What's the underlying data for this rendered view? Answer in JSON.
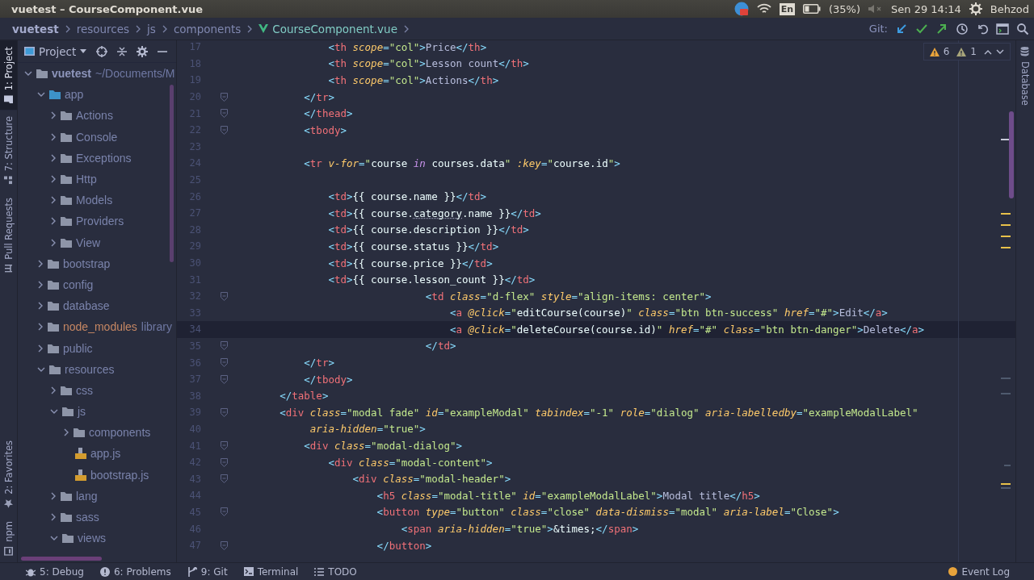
{
  "window": {
    "title": "vuetest – CourseComponent.vue"
  },
  "system_tray": {
    "keyboard": "En",
    "battery": "(35%)",
    "clock": "Sen 29 14:14",
    "user": "Behzod"
  },
  "breadcrumbs": [
    {
      "label": "vuetest",
      "kind": "project"
    },
    {
      "label": "resources",
      "kind": "folder"
    },
    {
      "label": "js",
      "kind": "folder"
    },
    {
      "label": "components",
      "kind": "folder"
    },
    {
      "label": "CourseComponent.vue",
      "kind": "vue"
    }
  ],
  "git_toolbar": {
    "label": "Git:"
  },
  "left_tool_tabs": [
    {
      "label": "1: Project",
      "selected": true,
      "kind": "project"
    },
    {
      "label": "7: Structure",
      "selected": false,
      "kind": "structure"
    },
    {
      "label": "Pull Requests",
      "selected": false,
      "kind": "pull"
    }
  ],
  "left_tool_tabs_bottom": [
    {
      "label": "2: Favorites",
      "selected": false,
      "kind": "favorites"
    },
    {
      "label": "npm",
      "selected": false,
      "kind": "npm"
    }
  ],
  "right_tool_tabs": [
    {
      "label": "Database",
      "selected": false,
      "kind": "database"
    }
  ],
  "project_panel": {
    "title": "Project",
    "tree": [
      {
        "label": "vuetest",
        "path": "~/Documents/M",
        "kind": "root",
        "expanded": true,
        "children": [
          {
            "label": "app",
            "kind": "source",
            "expanded": true,
            "children": [
              {
                "label": "Actions",
                "kind": "folder",
                "expanded": false
              },
              {
                "label": "Console",
                "kind": "folder",
                "expanded": false
              },
              {
                "label": "Exceptions",
                "kind": "folder",
                "expanded": false
              },
              {
                "label": "Http",
                "kind": "folder",
                "expanded": false
              },
              {
                "label": "Models",
                "kind": "folder",
                "expanded": false
              },
              {
                "label": "Providers",
                "kind": "folder",
                "expanded": false
              },
              {
                "label": "View",
                "kind": "folder",
                "expanded": false
              }
            ]
          },
          {
            "label": "bootstrap",
            "kind": "folder",
            "expanded": false
          },
          {
            "label": "config",
            "kind": "folder",
            "expanded": false
          },
          {
            "label": "database",
            "kind": "folder",
            "expanded": false
          },
          {
            "label": "node_modules",
            "note": "library",
            "kind": "excluded",
            "expanded": false
          },
          {
            "label": "public",
            "kind": "folder",
            "expanded": false
          },
          {
            "label": "resources",
            "kind": "folder",
            "expanded": true,
            "children": [
              {
                "label": "css",
                "kind": "folder",
                "expanded": false
              },
              {
                "label": "js",
                "kind": "folder",
                "expanded": true,
                "children": [
                  {
                    "label": "components",
                    "kind": "folder",
                    "expanded": false
                  },
                  {
                    "label": "app.js",
                    "kind": "js"
                  },
                  {
                    "label": "bootstrap.js",
                    "kind": "js"
                  }
                ]
              },
              {
                "label": "lang",
                "kind": "folder",
                "expanded": false
              },
              {
                "label": "sass",
                "kind": "folder",
                "expanded": false
              },
              {
                "label": "views",
                "kind": "folder",
                "expanded": true
              }
            ]
          }
        ]
      }
    ]
  },
  "inspections": {
    "warnings": "6",
    "weak_warnings": "1"
  },
  "editor": {
    "lines": [
      {
        "number": "17",
        "fold": false,
        "current": false,
        "segments": [
          {
            "kind": "b",
            "text": "                <"
          },
          {
            "kind": "tag",
            "text": "th"
          },
          {
            "kind": "attr",
            "text": " scope"
          },
          {
            "kind": "b",
            "text": "="
          },
          {
            "kind": "str",
            "text": "\"col\""
          },
          {
            "kind": "b",
            "text": ">"
          },
          {
            "kind": "text",
            "text": "Price"
          },
          {
            "kind": "b",
            "text": "</"
          },
          {
            "kind": "tag",
            "text": "th"
          },
          {
            "kind": "b",
            "text": ">"
          }
        ]
      },
      {
        "number": "18",
        "fold": false,
        "current": false,
        "segments": [
          {
            "kind": "b",
            "text": "                <"
          },
          {
            "kind": "tag",
            "text": "th"
          },
          {
            "kind": "attr",
            "text": " scope"
          },
          {
            "kind": "b",
            "text": "="
          },
          {
            "kind": "str",
            "text": "\"col\""
          },
          {
            "kind": "b",
            "text": ">"
          },
          {
            "kind": "text",
            "text": "Lesson count"
          },
          {
            "kind": "b",
            "text": "</"
          },
          {
            "kind": "tag",
            "text": "th"
          },
          {
            "kind": "b",
            "text": ">"
          }
        ]
      },
      {
        "number": "19",
        "fold": false,
        "current": false,
        "segments": [
          {
            "kind": "b",
            "text": "                <"
          },
          {
            "kind": "tag",
            "text": "th"
          },
          {
            "kind": "attr",
            "text": " scope"
          },
          {
            "kind": "b",
            "text": "="
          },
          {
            "kind": "str",
            "text": "\"col\""
          },
          {
            "kind": "b",
            "text": ">"
          },
          {
            "kind": "text",
            "text": "Actions"
          },
          {
            "kind": "b",
            "text": "</"
          },
          {
            "kind": "tag",
            "text": "th"
          },
          {
            "kind": "b",
            "text": ">"
          }
        ]
      },
      {
        "number": "20",
        "fold": true,
        "current": false,
        "segments": [
          {
            "kind": "b",
            "text": "            </"
          },
          {
            "kind": "tag",
            "text": "tr"
          },
          {
            "kind": "b",
            "text": ">"
          }
        ]
      },
      {
        "number": "21",
        "fold": true,
        "current": false,
        "segments": [
          {
            "kind": "b",
            "text": "            </"
          },
          {
            "kind": "tag",
            "text": "thead"
          },
          {
            "kind": "b",
            "text": ">"
          }
        ]
      },
      {
        "number": "22",
        "fold": true,
        "current": false,
        "segments": [
          {
            "kind": "b",
            "text": "            <"
          },
          {
            "kind": "tag",
            "text": "tbody"
          },
          {
            "kind": "b",
            "text": ">"
          }
        ]
      },
      {
        "number": "23",
        "fold": false,
        "current": false
      },
      {
        "number": "24",
        "fold": false,
        "current": false,
        "segments": [
          {
            "kind": "b",
            "text": "            <"
          },
          {
            "kind": "tag",
            "text": "tr"
          },
          {
            "kind": "attr",
            "text": " v-for"
          },
          {
            "kind": "b",
            "text": "="
          },
          {
            "kind": "str",
            "text": "\""
          },
          {
            "kind": "js",
            "text": "course "
          },
          {
            "kind": "kw",
            "text": "in"
          },
          {
            "kind": "js",
            "text": " courses.data"
          },
          {
            "kind": "str",
            "text": "\""
          },
          {
            "kind": "attr",
            "text": " :key"
          },
          {
            "kind": "b",
            "text": "="
          },
          {
            "kind": "str",
            "text": "\""
          },
          {
            "kind": "js",
            "text": "course.id"
          },
          {
            "kind": "str",
            "text": "\""
          },
          {
            "kind": "b",
            "text": ">"
          }
        ]
      },
      {
        "number": "25",
        "fold": false,
        "current": false
      },
      {
        "number": "26",
        "fold": false,
        "current": false,
        "segments": [
          {
            "kind": "b",
            "text": "                <"
          },
          {
            "kind": "tag",
            "text": "td"
          },
          {
            "kind": "b",
            "text": ">"
          },
          {
            "kind": "js",
            "text": "{{ course.name }}"
          },
          {
            "kind": "b",
            "text": "</"
          },
          {
            "kind": "tag",
            "text": "td"
          },
          {
            "kind": "b",
            "text": ">"
          }
        ]
      },
      {
        "number": "27",
        "fold": false,
        "current": false,
        "segments": [
          {
            "kind": "b",
            "text": "                <"
          },
          {
            "kind": "tag",
            "text": "td"
          },
          {
            "kind": "b",
            "text": ">"
          },
          {
            "kind": "js",
            "text": "{{ course."
          },
          {
            "kind": "warn",
            "text": "category"
          },
          {
            "kind": "js",
            "text": ".name }}"
          },
          {
            "kind": "b",
            "text": "</"
          },
          {
            "kind": "tag",
            "text": "td"
          },
          {
            "kind": "b",
            "text": ">"
          }
        ]
      },
      {
        "number": "28",
        "fold": false,
        "current": false,
        "segments": [
          {
            "kind": "b",
            "text": "                <"
          },
          {
            "kind": "tag",
            "text": "td"
          },
          {
            "kind": "b",
            "text": ">"
          },
          {
            "kind": "js",
            "text": "{{ course.description }}"
          },
          {
            "kind": "b",
            "text": "</"
          },
          {
            "kind": "tag",
            "text": "td"
          },
          {
            "kind": "b",
            "text": ">"
          }
        ]
      },
      {
        "number": "29",
        "fold": false,
        "current": false,
        "segments": [
          {
            "kind": "b",
            "text": "                <"
          },
          {
            "kind": "tag",
            "text": "td"
          },
          {
            "kind": "b",
            "text": ">"
          },
          {
            "kind": "js",
            "text": "{{ course.status }}"
          },
          {
            "kind": "b",
            "text": "</"
          },
          {
            "kind": "tag",
            "text": "td"
          },
          {
            "kind": "b",
            "text": ">"
          }
        ]
      },
      {
        "number": "30",
        "fold": false,
        "current": false,
        "segments": [
          {
            "kind": "b",
            "text": "                <"
          },
          {
            "kind": "tag",
            "text": "td"
          },
          {
            "kind": "b",
            "text": ">"
          },
          {
            "kind": "js",
            "text": "{{ course.price }}"
          },
          {
            "kind": "b",
            "text": "</"
          },
          {
            "kind": "tag",
            "text": "td"
          },
          {
            "kind": "b",
            "text": ">"
          }
        ]
      },
      {
        "number": "31",
        "fold": false,
        "current": false,
        "segments": [
          {
            "kind": "b",
            "text": "                <"
          },
          {
            "kind": "tag",
            "text": "td"
          },
          {
            "kind": "b",
            "text": ">"
          },
          {
            "kind": "js",
            "text": "{{ course.lesson_count }}"
          },
          {
            "kind": "b",
            "text": "</"
          },
          {
            "kind": "tag",
            "text": "td"
          },
          {
            "kind": "b",
            "text": ">"
          }
        ]
      },
      {
        "number": "32",
        "fold": true,
        "current": false,
        "segments": [
          {
            "kind": "b",
            "text": "                                <"
          },
          {
            "kind": "tag",
            "text": "td"
          },
          {
            "kind": "attr",
            "text": " class"
          },
          {
            "kind": "b",
            "text": "="
          },
          {
            "kind": "str",
            "text": "\"d-flex\""
          },
          {
            "kind": "attr",
            "text": " style"
          },
          {
            "kind": "b",
            "text": "="
          },
          {
            "kind": "str",
            "text": "\"align-items: center\""
          },
          {
            "kind": "b",
            "text": ">"
          }
        ]
      },
      {
        "number": "33",
        "fold": false,
        "current": false,
        "segments": [
          {
            "kind": "b",
            "text": "                                    <"
          },
          {
            "kind": "tag",
            "text": "a"
          },
          {
            "kind": "attr",
            "text": " @click"
          },
          {
            "kind": "b",
            "text": "="
          },
          {
            "kind": "str",
            "text": "\""
          },
          {
            "kind": "js",
            "text": "editCourse(course)"
          },
          {
            "kind": "str",
            "text": "\""
          },
          {
            "kind": "attr",
            "text": " class"
          },
          {
            "kind": "b",
            "text": "="
          },
          {
            "kind": "str",
            "text": "\"btn btn-success\""
          },
          {
            "kind": "attr",
            "text": " href"
          },
          {
            "kind": "b",
            "text": "="
          },
          {
            "kind": "str",
            "text": "\"#\""
          },
          {
            "kind": "b",
            "text": ">"
          },
          {
            "kind": "text",
            "text": "Edit"
          },
          {
            "kind": "b",
            "text": "</"
          },
          {
            "kind": "tag",
            "text": "a"
          },
          {
            "kind": "b",
            "text": ">"
          }
        ]
      },
      {
        "number": "34",
        "fold": false,
        "current": true,
        "segments": [
          {
            "kind": "b",
            "text": "                                    <"
          },
          {
            "kind": "tag",
            "text": "a"
          },
          {
            "kind": "attr",
            "text": " @click"
          },
          {
            "kind": "b",
            "text": "="
          },
          {
            "kind": "str",
            "text": "\""
          },
          {
            "kind": "js",
            "text": "deleteCourse(course.id)"
          },
          {
            "kind": "str",
            "text": "\""
          },
          {
            "kind": "attr",
            "text": " href"
          },
          {
            "kind": "b",
            "text": "="
          },
          {
            "kind": "str",
            "text": "\"#\""
          },
          {
            "kind": "attr",
            "text": " class"
          },
          {
            "kind": "b",
            "text": "="
          },
          {
            "kind": "str",
            "text": "\"btn btn-danger\""
          },
          {
            "kind": "b",
            "text": ">"
          },
          {
            "kind": "text",
            "text": "Delete"
          },
          {
            "kind": "b",
            "text": "</"
          },
          {
            "kind": "tag",
            "text": "a"
          },
          {
            "kind": "b",
            "text": ">"
          }
        ]
      },
      {
        "number": "35",
        "fold": true,
        "current": false,
        "segments": [
          {
            "kind": "b",
            "text": "                                </"
          },
          {
            "kind": "tag",
            "text": "td"
          },
          {
            "kind": "b",
            "text": ">"
          }
        ]
      },
      {
        "number": "36",
        "fold": true,
        "current": false,
        "segments": [
          {
            "kind": "b",
            "text": "            </"
          },
          {
            "kind": "tag",
            "text": "tr"
          },
          {
            "kind": "b",
            "text": ">"
          }
        ]
      },
      {
        "number": "37",
        "fold": true,
        "current": false,
        "segments": [
          {
            "kind": "b",
            "text": "            </"
          },
          {
            "kind": "tag",
            "text": "tbody"
          },
          {
            "kind": "b",
            "text": ">"
          }
        ]
      },
      {
        "number": "38",
        "fold": false,
        "current": false,
        "segments": [
          {
            "kind": "b",
            "text": "        </"
          },
          {
            "kind": "tag",
            "text": "table"
          },
          {
            "kind": "b",
            "text": ">"
          }
        ]
      },
      {
        "number": "39",
        "fold": true,
        "current": false,
        "segments": [
          {
            "kind": "b",
            "text": "        <"
          },
          {
            "kind": "tag",
            "text": "div"
          },
          {
            "kind": "attr",
            "text": " class"
          },
          {
            "kind": "b",
            "text": "="
          },
          {
            "kind": "str",
            "text": "\"modal fade\""
          },
          {
            "kind": "attr",
            "text": " id"
          },
          {
            "kind": "b",
            "text": "="
          },
          {
            "kind": "str",
            "text": "\"exampleModal\""
          },
          {
            "kind": "attr",
            "text": " tabindex"
          },
          {
            "kind": "b",
            "text": "="
          },
          {
            "kind": "str",
            "text": "\"-1\""
          },
          {
            "kind": "attr",
            "text": " role"
          },
          {
            "kind": "b",
            "text": "="
          },
          {
            "kind": "str",
            "text": "\"dialog\""
          },
          {
            "kind": "attr",
            "text": " aria-labelledby"
          },
          {
            "kind": "b",
            "text": "="
          },
          {
            "kind": "str",
            "text": "\"exampleModalLabel\""
          }
        ]
      },
      {
        "number": "40",
        "fold": false,
        "current": false,
        "segments": [
          {
            "kind": "attr",
            "text": "             aria-hidden"
          },
          {
            "kind": "b",
            "text": "="
          },
          {
            "kind": "str",
            "text": "\"true\""
          },
          {
            "kind": "b",
            "text": ">"
          }
        ]
      },
      {
        "number": "41",
        "fold": true,
        "current": false,
        "segments": [
          {
            "kind": "b",
            "text": "            <"
          },
          {
            "kind": "tag",
            "text": "div"
          },
          {
            "kind": "attr",
            "text": " class"
          },
          {
            "kind": "b",
            "text": "="
          },
          {
            "kind": "str",
            "text": "\"modal-dialog\""
          },
          {
            "kind": "b",
            "text": ">"
          }
        ]
      },
      {
        "number": "42",
        "fold": true,
        "current": false,
        "segments": [
          {
            "kind": "b",
            "text": "                <"
          },
          {
            "kind": "tag",
            "text": "div"
          },
          {
            "kind": "attr",
            "text": " class"
          },
          {
            "kind": "b",
            "text": "="
          },
          {
            "kind": "str",
            "text": "\"modal-content\""
          },
          {
            "kind": "b",
            "text": ">"
          }
        ]
      },
      {
        "number": "43",
        "fold": true,
        "current": false,
        "segments": [
          {
            "kind": "b",
            "text": "                    <"
          },
          {
            "kind": "tag",
            "text": "div"
          },
          {
            "kind": "attr",
            "text": " class"
          },
          {
            "kind": "b",
            "text": "="
          },
          {
            "kind": "str",
            "text": "\"modal-header\""
          },
          {
            "kind": "b",
            "text": ">"
          }
        ]
      },
      {
        "number": "44",
        "fold": false,
        "current": false,
        "segments": [
          {
            "kind": "b",
            "text": "                        <"
          },
          {
            "kind": "tag",
            "text": "h5"
          },
          {
            "kind": "attr",
            "text": " class"
          },
          {
            "kind": "b",
            "text": "="
          },
          {
            "kind": "str",
            "text": "\"modal-title\""
          },
          {
            "kind": "attr",
            "text": " id"
          },
          {
            "kind": "b",
            "text": "="
          },
          {
            "kind": "str",
            "text": "\"exampleModalLabel\""
          },
          {
            "kind": "b",
            "text": ">"
          },
          {
            "kind": "text",
            "text": "Modal title"
          },
          {
            "kind": "b",
            "text": "</"
          },
          {
            "kind": "tag",
            "text": "h5"
          },
          {
            "kind": "b",
            "text": ">"
          }
        ]
      },
      {
        "number": "45",
        "fold": true,
        "current": false,
        "segments": [
          {
            "kind": "b",
            "text": "                        <"
          },
          {
            "kind": "tag",
            "text": "button"
          },
          {
            "kind": "attr",
            "text": " type"
          },
          {
            "kind": "b",
            "text": "="
          },
          {
            "kind": "str",
            "text": "\"button\""
          },
          {
            "kind": "attr",
            "text": " class"
          },
          {
            "kind": "b",
            "text": "="
          },
          {
            "kind": "str",
            "text": "\"close\""
          },
          {
            "kind": "attr",
            "text": " data-dismiss"
          },
          {
            "kind": "b",
            "text": "="
          },
          {
            "kind": "str",
            "text": "\"modal\""
          },
          {
            "kind": "attr",
            "text": " aria-label"
          },
          {
            "kind": "b",
            "text": "="
          },
          {
            "kind": "str",
            "text": "\"Close\""
          },
          {
            "kind": "b",
            "text": ">"
          }
        ]
      },
      {
        "number": "46",
        "fold": false,
        "current": false,
        "segments": [
          {
            "kind": "b",
            "text": "                            <"
          },
          {
            "kind": "tag",
            "text": "span"
          },
          {
            "kind": "attr",
            "text": " aria-hidden"
          },
          {
            "kind": "b",
            "text": "="
          },
          {
            "kind": "str",
            "text": "\"true\""
          },
          {
            "kind": "b",
            "text": ">"
          },
          {
            "kind": "js",
            "text": "&times;"
          },
          {
            "kind": "b",
            "text": "</"
          },
          {
            "kind": "tag",
            "text": "span"
          },
          {
            "kind": "b",
            "text": ">"
          }
        ]
      },
      {
        "number": "47",
        "fold": true,
        "current": false,
        "segments": [
          {
            "kind": "b",
            "text": "                        </"
          },
          {
            "kind": "tag",
            "text": "button"
          },
          {
            "kind": "b",
            "text": ">"
          }
        ]
      }
    ]
  },
  "status_bar": [
    {
      "label": "5: Debug",
      "kind": "debug"
    },
    {
      "label": "6: Problems",
      "kind": "problems"
    },
    {
      "label": "9: Git",
      "kind": "git"
    },
    {
      "label": "Terminal",
      "kind": "terminal"
    },
    {
      "label": "TODO",
      "kind": "todo"
    }
  ],
  "event_log": {
    "label": "Event Log"
  }
}
